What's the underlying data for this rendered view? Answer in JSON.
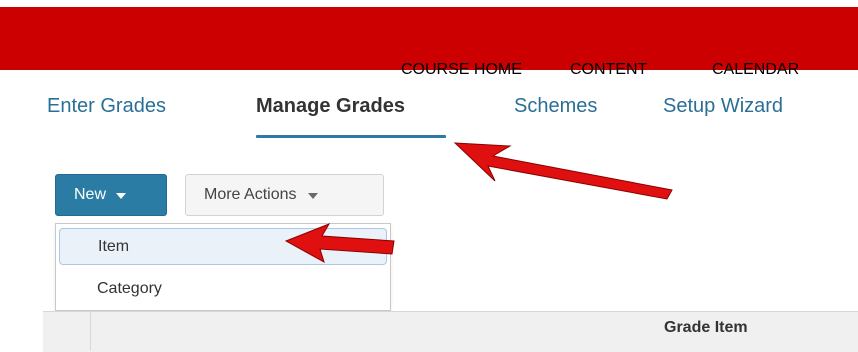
{
  "top_nav": {
    "items": [
      "COURSE HOME",
      "CONTENT",
      "CALENDAR"
    ]
  },
  "tabs": [
    {
      "label": "Enter Grades",
      "active": false
    },
    {
      "label": "Manage Grades",
      "active": true
    },
    {
      "label": "Schemes",
      "active": false
    },
    {
      "label": "Setup Wizard",
      "active": false
    }
  ],
  "toolbar": {
    "new_label": "New",
    "more_actions_label": "More Actions"
  },
  "new_menu": {
    "items": [
      "Item",
      "Category"
    ],
    "highlighted": "Item"
  },
  "table": {
    "headers": [
      "",
      "Grade Item"
    ]
  },
  "colors": {
    "topbar": "#cc0000",
    "accent": "#2b7ca5",
    "annotation_arrow": "#ee1111"
  }
}
